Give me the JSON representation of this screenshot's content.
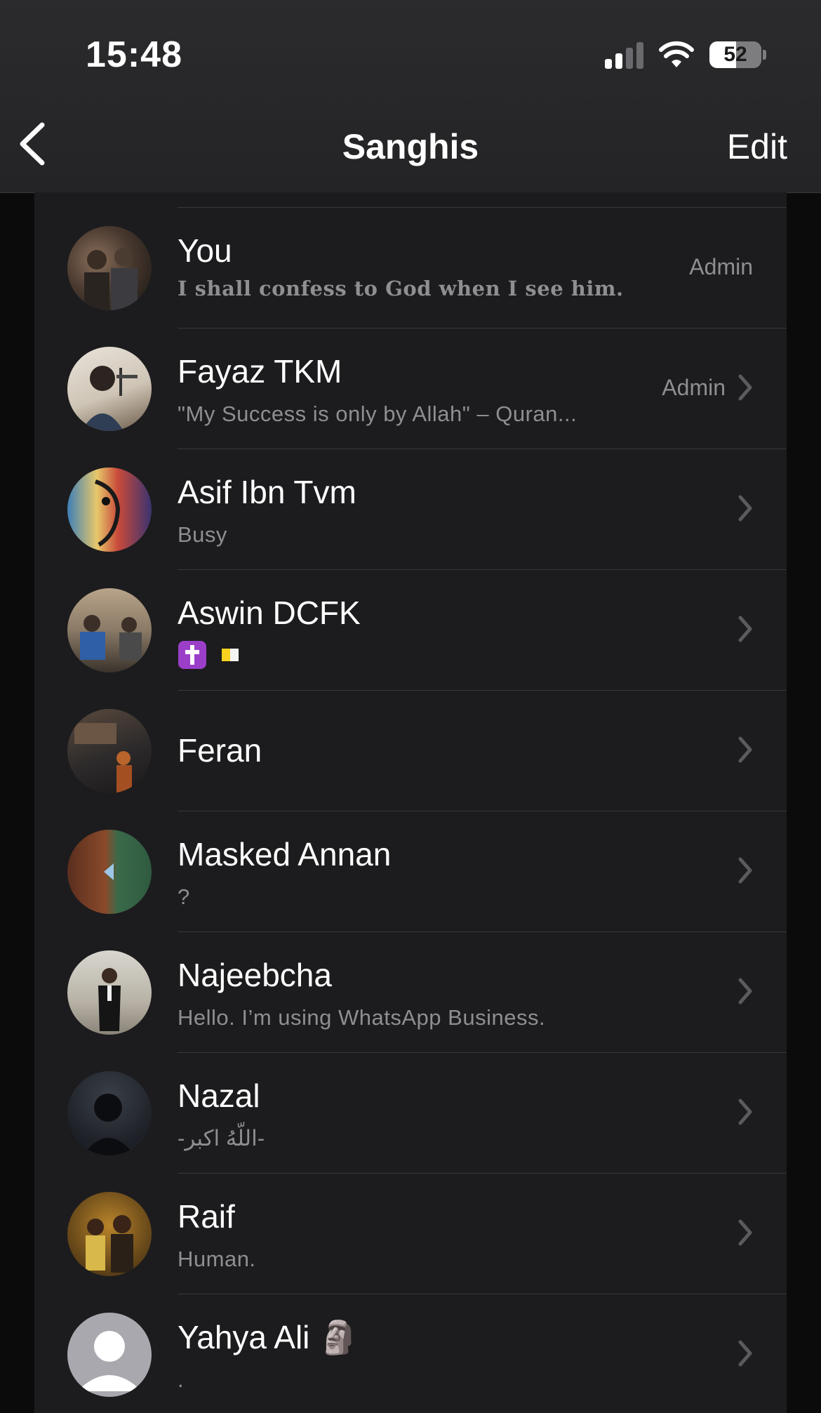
{
  "status_bar": {
    "time": "15:48",
    "battery": "52",
    "battery_level": 0.52
  },
  "nav": {
    "title": "Sanghis",
    "edit_label": "Edit"
  },
  "participants": [
    {
      "name": "You",
      "status": "I shall confess to God when I see him.",
      "role": "Admin"
    },
    {
      "name": "Fayaz TKM",
      "status": "\"My Success is only by Allah\" – Quran...",
      "role": "Admin"
    },
    {
      "name": "Asif Ibn Tvm",
      "status": "Busy",
      "role": ""
    },
    {
      "name": "Aswin DCFK",
      "status": "✝️ 🇻🇦",
      "role": ""
    },
    {
      "name": "Feran",
      "status": "",
      "role": ""
    },
    {
      "name": "Masked Annan",
      "status": "?",
      "role": ""
    },
    {
      "name": "Najeebcha",
      "status": "Hello. I’m using WhatsApp Business.",
      "role": ""
    },
    {
      "name": "Nazal",
      "status": "-اللّهُ اكبر-",
      "role": ""
    },
    {
      "name": "Raif",
      "status": "Human.",
      "role": ""
    },
    {
      "name": "Yahya Ali 🗿",
      "status": ".",
      "role": ""
    }
  ],
  "icons": {
    "back": "chevron-left-icon",
    "row": "chevron-right-icon",
    "wifi": "wifi-icon",
    "signal": "cellular-signal-icon",
    "battery": "battery-icon"
  }
}
